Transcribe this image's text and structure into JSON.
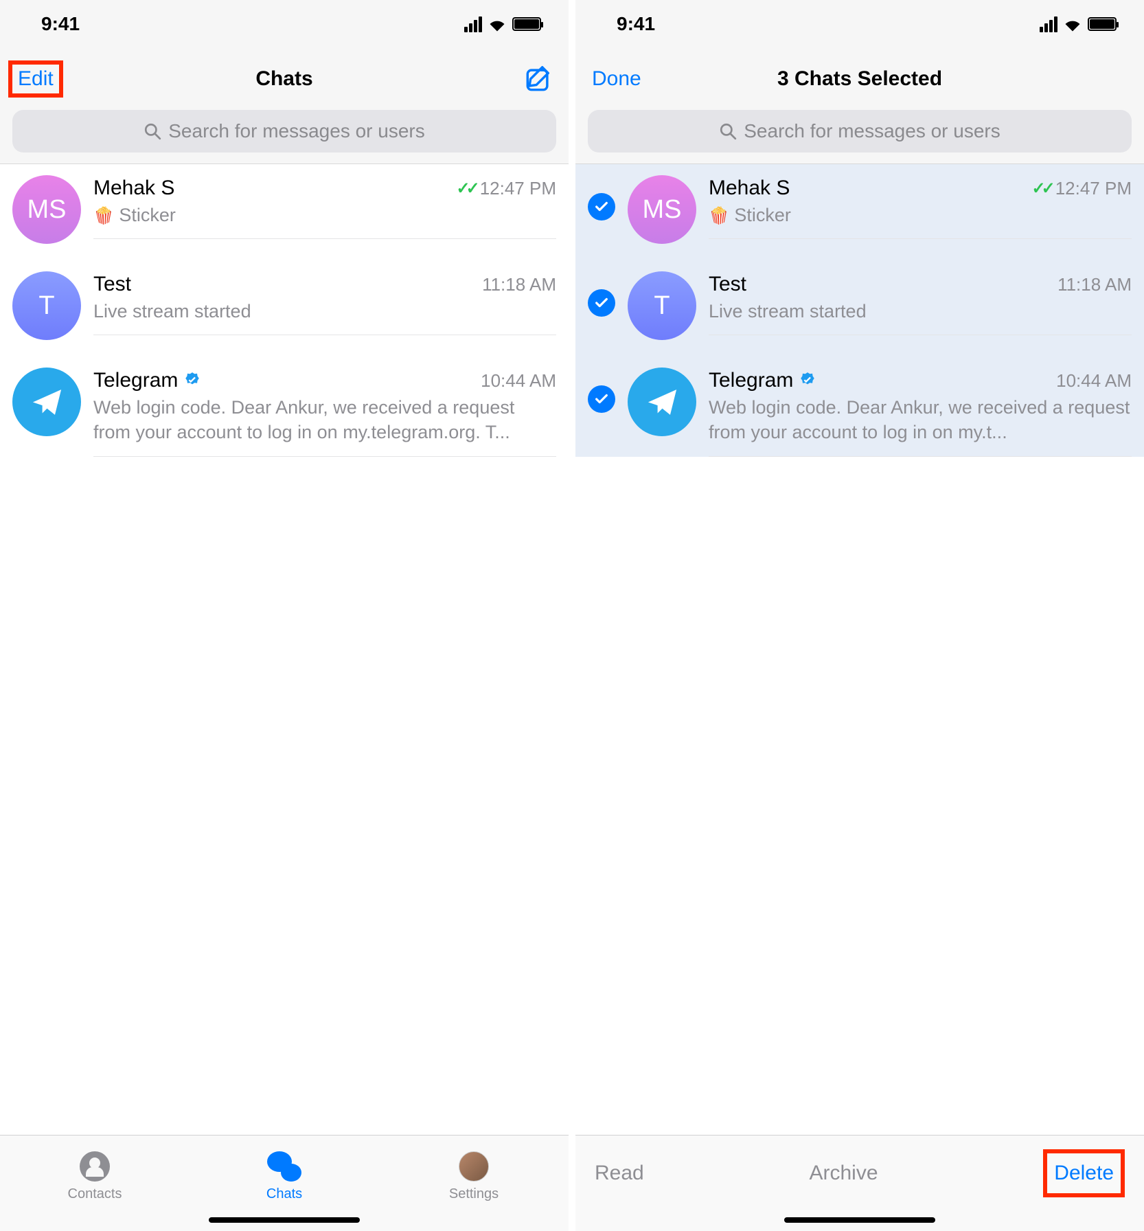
{
  "colors": {
    "accent": "#007aff",
    "highlight": "#ff2a00",
    "muted": "#8e8e93"
  },
  "status": {
    "time": "9:41"
  },
  "left": {
    "nav": {
      "leftLabel": "Edit",
      "title": "Chats"
    },
    "search": {
      "placeholder": "Search for messages or users"
    },
    "chats": [
      {
        "name": "Mehak S",
        "initials": "MS",
        "preview": "Sticker",
        "time": "12:47 PM",
        "read": true,
        "sticker": true
      },
      {
        "name": "Test",
        "initials": "T",
        "preview": "Live stream started",
        "time": "11:18 AM",
        "read": false
      },
      {
        "name": "Telegram",
        "preview": "Web login code. Dear Ankur, we received a request from your account to log in on my.telegram.org. T...",
        "time": "10:44 AM",
        "verified": true,
        "telegram": true
      }
    ],
    "tabs": {
      "contacts": "Contacts",
      "chats": "Chats",
      "settings": "Settings"
    }
  },
  "right": {
    "nav": {
      "leftLabel": "Done",
      "title": "3 Chats Selected"
    },
    "search": {
      "placeholder": "Search for messages or users"
    },
    "chats": [
      {
        "name": "Mehak S",
        "initials": "MS",
        "preview": "Sticker",
        "time": "12:47 PM",
        "read": true,
        "sticker": true,
        "selected": true
      },
      {
        "name": "Test",
        "initials": "T",
        "preview": "Live stream started",
        "time": "11:18 AM",
        "read": false,
        "selected": true
      },
      {
        "name": "Telegram",
        "preview": "Web login code. Dear Ankur, we received a request from your account to log in on my.t...",
        "time": "10:44 AM",
        "verified": true,
        "telegram": true,
        "selected": true
      }
    ],
    "actions": {
      "read": "Read",
      "archive": "Archive",
      "delete": "Delete"
    }
  }
}
